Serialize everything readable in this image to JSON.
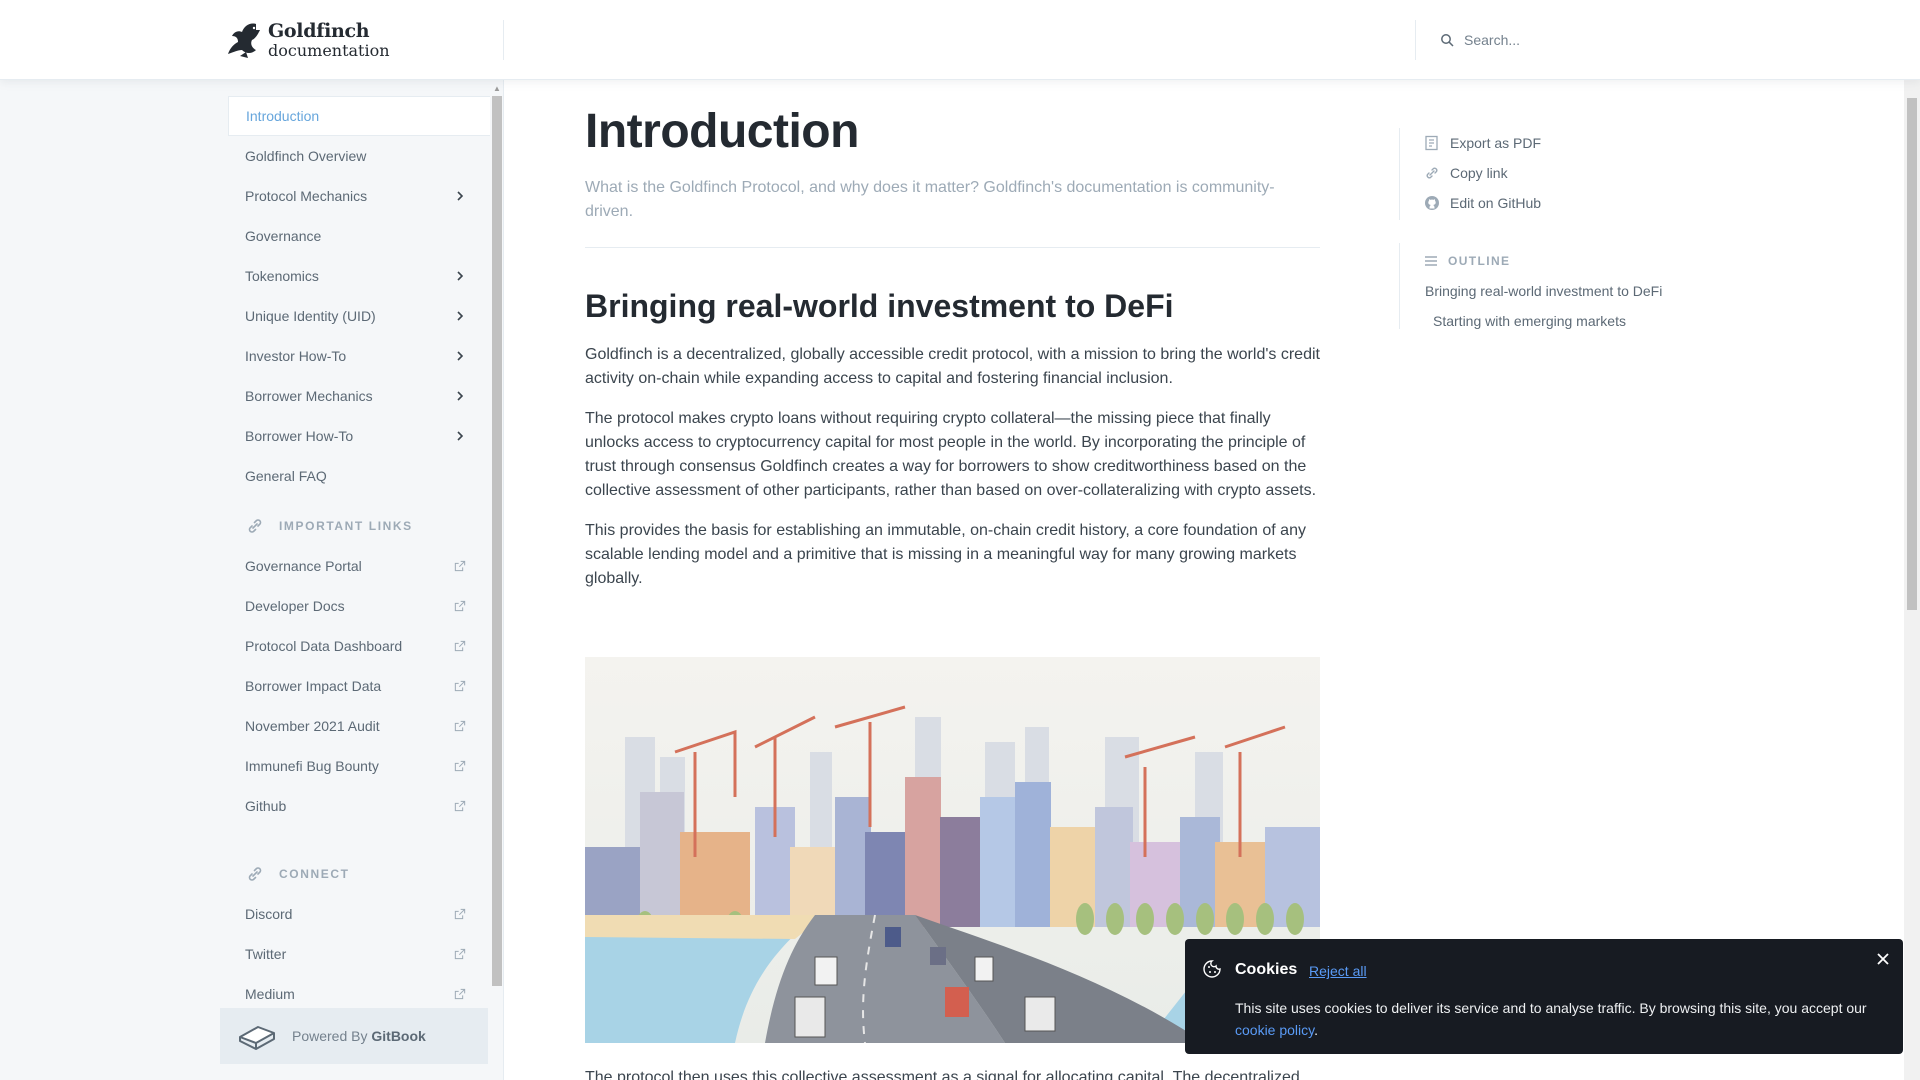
{
  "header": {
    "logo_title": "Goldfinch",
    "logo_sub": "documentation",
    "search_placeholder": "Search..."
  },
  "sidebar": {
    "items": [
      {
        "label": "Introduction",
        "active": true,
        "chevron": false
      },
      {
        "label": "Goldfinch Overview",
        "chevron": false
      },
      {
        "label": "Protocol Mechanics",
        "chevron": true
      },
      {
        "label": "Governance",
        "chevron": false
      },
      {
        "label": "Tokenomics",
        "chevron": true
      },
      {
        "label": "Unique Identity (UID)",
        "chevron": true
      },
      {
        "label": "Investor How-To",
        "chevron": true
      },
      {
        "label": "Borrower Mechanics",
        "chevron": true
      },
      {
        "label": "Borrower How-To",
        "chevron": true
      },
      {
        "label": "General FAQ",
        "chevron": false
      }
    ],
    "important_links_title": "IMPORTANT LINKS",
    "important_links": [
      "Governance Portal",
      "Developer Docs",
      "Protocol Data Dashboard",
      "Borrower Impact Data",
      "November 2021 Audit",
      "Immunefi Bug Bounty",
      "Github"
    ],
    "connect_title": "CONNECT",
    "connect_links": [
      "Discord",
      "Twitter",
      "Medium"
    ],
    "powered_by": "Powered By",
    "gitbook": "GitBook"
  },
  "main": {
    "title": "Introduction",
    "description": "What is the Goldfinch Protocol, and why does it matter?  Goldfinch's documentation is community-driven.",
    "heading": "Bringing real-world investment to DeFi",
    "paragraphs": [
      "Goldfinch is a decentralized, globally accessible credit protocol, with a mission to bring the world's credit activity on-chain while expanding access to capital and fostering financial inclusion.",
      "The protocol makes crypto loans without requiring crypto collateral—the missing piece that finally unlocks access to cryptocurrency capital for most people in the world. By incorporating the principle of trust through consensus Goldfinch creates a way for borrowers to show creditworthiness based on the collective assessment of other participants, rather than based on over-collateralizing with crypto assets.",
      "This provides the basis for establishing an immutable, on-chain credit history, a core foundation of any scalable lending model and a primitive that is missing in a meaningful way for many growing markets globally."
    ],
    "cut_paragraph": "The protocol then uses this collective assessment as a signal for allocating capital. The decentralized"
  },
  "aside": {
    "actions": [
      "Export as PDF",
      "Copy link",
      "Edit on GitHub"
    ],
    "outline_title": "OUTLINE",
    "outline": [
      "Bringing real-world investment to DeFi",
      "Starting with emerging markets"
    ]
  },
  "cookie": {
    "title": "Cookies",
    "reject": "Reject all",
    "text": "This site uses cookies to deliver its service and to analyse traffic. By browsing this site, you accept our",
    "link": "cookie policy",
    "period": "."
  },
  "colors": {
    "accent": "#67a6dc",
    "sidebar_bg": "#f5f7f9",
    "banner_bg": "#171b22"
  }
}
